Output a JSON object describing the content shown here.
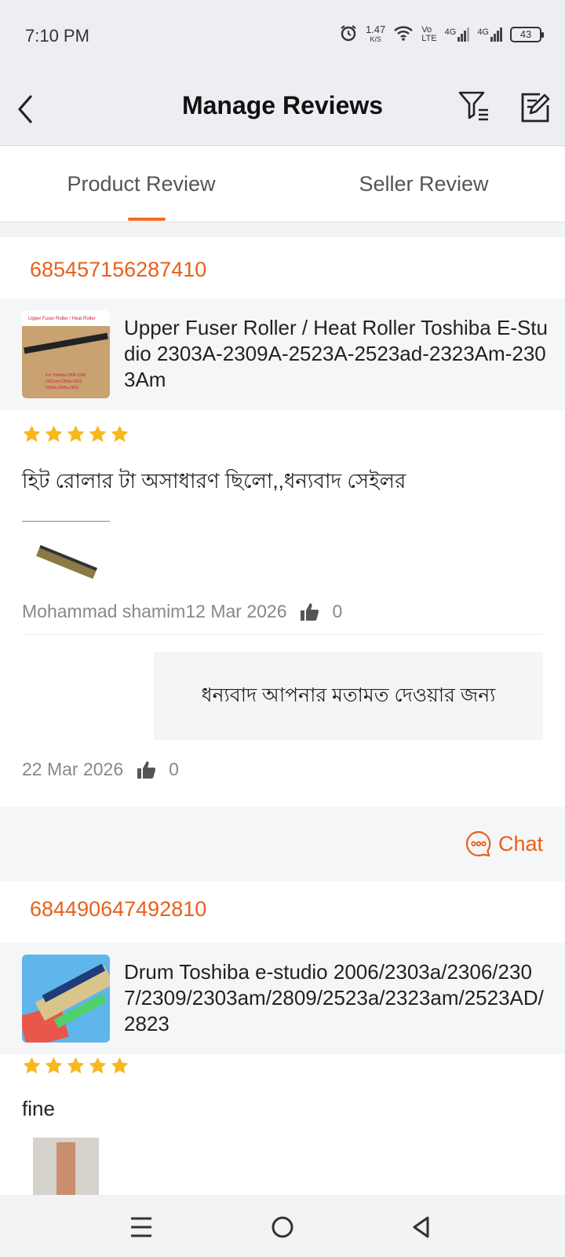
{
  "status_bar": {
    "time": "7:10 PM",
    "net_speed_value": "1.47",
    "net_speed_unit": "K/S",
    "volte_top": "Vo",
    "volte_bottom": "LTE",
    "signal1_label": "4G",
    "signal2_label": "4G",
    "battery": "43"
  },
  "header": {
    "title": "Manage Reviews"
  },
  "tabs": [
    {
      "label": "Product Review",
      "active": true
    },
    {
      "label": "Seller Review",
      "active": false
    }
  ],
  "reviews": [
    {
      "order_id": "685457156287410",
      "product_title": "Upper Fuser Roller / Heat Roller Toshiba E-Studio 2303A-2309A-2523A-2523ad-2323Am-2303Am",
      "product_image_text_top": "Upper Fuser Roller / Heat Roller",
      "product_image_text_bottom": "For Toshiba 2006-2306-2303a-2303am-2309a-2523ad-2323am-2309a-2505a-2823am-2829am",
      "rating": 5,
      "text": "হিট রোলার টা অসাধারণ ছিলো,,ধন্যবাদ সেইলর",
      "reviewer": "Mohammad shamim",
      "date": "12 Mar 2026",
      "likes": "0",
      "reply": {
        "text": "ধন্যবাদ আপনার মতামত দেওয়ার জন্য",
        "date": "22 Mar 2026",
        "likes": "0"
      },
      "chat_label": "Chat"
    },
    {
      "order_id": "684490647492810",
      "product_title": "Drum Toshiba e-studio 2006/2303a/2306/2307/2309/2303am/2809/2523a/2323am/2523AD/2823",
      "rating": 5,
      "text": "fine"
    }
  ],
  "colors": {
    "accent": "#e8601a",
    "star": "#f8b81c"
  }
}
